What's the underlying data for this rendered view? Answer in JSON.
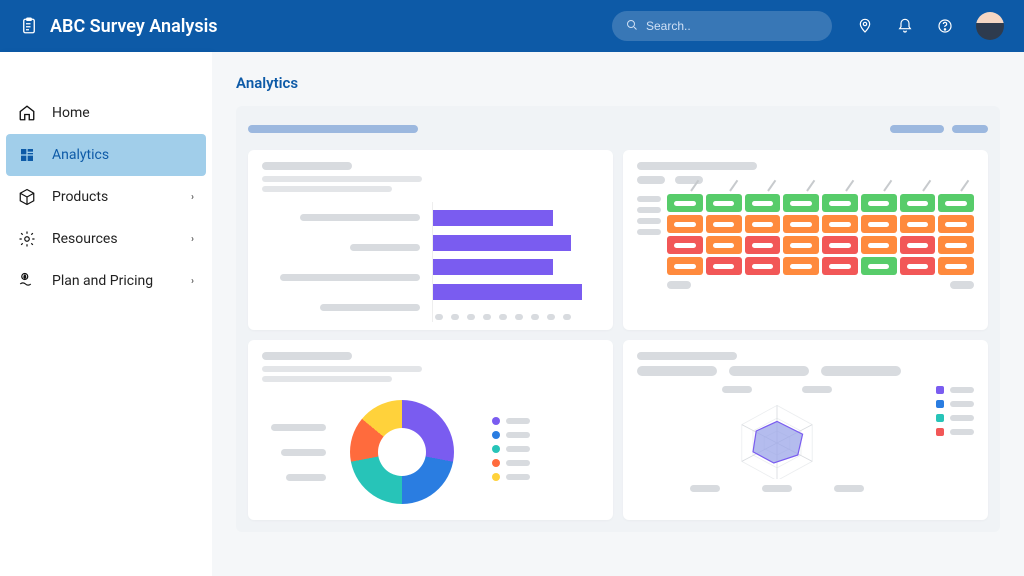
{
  "app_title": "ABC Survey Analysis",
  "search": {
    "placeholder": "Search.."
  },
  "sidebar": {
    "items": [
      {
        "label": "Home",
        "icon": "home-icon",
        "expandable": false,
        "active": false
      },
      {
        "label": "Analytics",
        "icon": "grid-icon",
        "expandable": false,
        "active": true
      },
      {
        "label": "Products",
        "icon": "box-icon",
        "expandable": true,
        "active": false
      },
      {
        "label": "Resources",
        "icon": "gear-icon",
        "expandable": true,
        "active": false
      },
      {
        "label": "Plan and Pricing",
        "icon": "pricing-icon",
        "expandable": true,
        "active": false
      }
    ]
  },
  "page": {
    "title": "Analytics"
  },
  "colors": {
    "brand": "#0d5aa7",
    "purple": "#7a5cf0",
    "blue": "#2a7de1",
    "teal": "#27c4b8",
    "orange": "#ff6b3d",
    "yellow": "#ffd23b",
    "green": "#57cc6a",
    "red": "#f25757",
    "orange2": "#ff8a3d"
  },
  "chart_data": [
    {
      "id": "cardA",
      "type": "bar",
      "orientation": "horizontal",
      "series": [
        {
          "name": "",
          "values": [
            72,
            83,
            72,
            90
          ]
        }
      ],
      "categories": [
        "",
        "",
        "",
        ""
      ],
      "xlabel": "",
      "ylabel": "",
      "xlim": [
        0,
        100
      ]
    },
    {
      "id": "cardB",
      "type": "heatmap",
      "rows": 4,
      "cols": 8,
      "categories_x": [
        "",
        "",
        "",
        "",
        "",
        "",
        "",
        ""
      ],
      "categories_y": [
        "",
        "",
        "",
        ""
      ],
      "palette": {
        "g": "#57cc6a",
        "o": "#ff8a3d",
        "r": "#f25757"
      },
      "cells": [
        [
          "g",
          "g",
          "g",
          "g",
          "g",
          "g",
          "g",
          "g"
        ],
        [
          "o",
          "o",
          "o",
          "o",
          "o",
          "o",
          "o",
          "o"
        ],
        [
          "r",
          "o",
          "r",
          "o",
          "r",
          "o",
          "r",
          "o"
        ],
        [
          "o",
          "r",
          "r",
          "o",
          "r",
          "g",
          "r",
          "o"
        ]
      ]
    },
    {
      "id": "cardC",
      "type": "pie",
      "variant": "donut",
      "series": [
        {
          "name": "",
          "value": 28,
          "color": "#7a5cf0"
        },
        {
          "name": "",
          "value": 22,
          "color": "#2a7de1"
        },
        {
          "name": "",
          "value": 22,
          "color": "#27c4b8"
        },
        {
          "name": "",
          "value": 14,
          "color": "#ff6b3d"
        },
        {
          "name": "",
          "value": 14,
          "color": "#ffd23b"
        }
      ]
    },
    {
      "id": "cardD",
      "type": "radar",
      "axes": [
        "",
        "",
        "",
        "",
        "",
        ""
      ],
      "series": [
        {
          "name": "",
          "color": "#7a5cf0",
          "values": [
            0.7,
            0.55,
            0.6,
            0.45,
            0.8,
            0.5
          ]
        }
      ],
      "legend_colors": [
        "#7a5cf0",
        "#2a7de1",
        "#27c4b8",
        "#f25757"
      ]
    }
  ]
}
